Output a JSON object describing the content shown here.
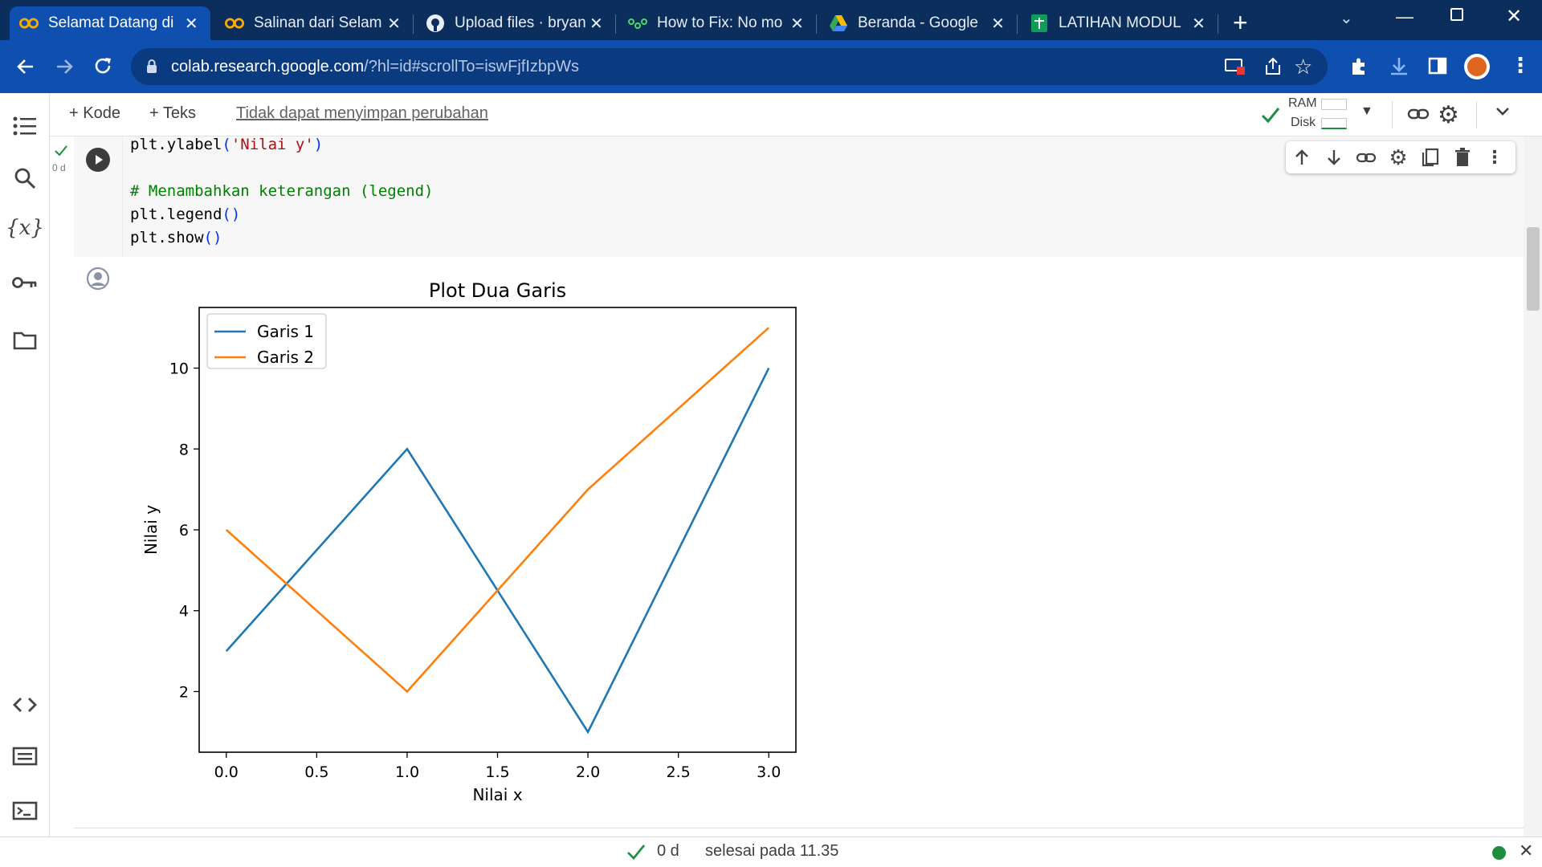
{
  "browser": {
    "tabs": [
      {
        "title": "Selamat Datang di",
        "icon": "colab-icon",
        "active": true
      },
      {
        "title": "Salinan dari Selam",
        "icon": "colab-icon",
        "active": false
      },
      {
        "title": "Upload files · bryan",
        "icon": "github-icon",
        "active": false
      },
      {
        "title": "How to Fix: No mo",
        "icon": "share-nodes-icon",
        "active": false
      },
      {
        "title": "Beranda - Google",
        "icon": "drive-icon",
        "active": false
      },
      {
        "title": "LATIHAN MODUL",
        "icon": "sheets-icon",
        "active": false
      }
    ],
    "url_domain": "colab.research.google.com",
    "url_path": "/?hl=id#scrollTo=iswFjfIzbpWs"
  },
  "colab": {
    "add_code_label": "+ Kode",
    "add_text_label": "+ Teks",
    "unsaved_notice": "Tidak dapat menyimpan perubahan",
    "ram_label": "RAM",
    "disk_label": "Disk"
  },
  "cell": {
    "exec_time": "0 d",
    "code_lines": [
      {
        "parts": [
          [
            "plain",
            "plt.ylabel"
          ],
          [
            "par",
            "("
          ],
          [
            "str",
            "'Nilai y'"
          ],
          [
            "par",
            ")"
          ]
        ]
      },
      {
        "parts": [
          [
            "plain",
            ""
          ]
        ]
      },
      {
        "parts": [
          [
            "cmt",
            "# Menambahkan keterangan (legend)"
          ]
        ]
      },
      {
        "parts": [
          [
            "plain",
            "plt.legend"
          ],
          [
            "par",
            "()"
          ]
        ]
      },
      {
        "parts": [
          [
            "plain",
            "plt.show"
          ],
          [
            "par",
            "()"
          ]
        ]
      }
    ]
  },
  "chart_data": {
    "type": "line",
    "title": "Plot Dua Garis",
    "xlabel": "Nilai x",
    "ylabel": "Nilai y",
    "x": [
      0,
      1,
      2,
      3
    ],
    "series": [
      {
        "name": "Garis 1",
        "values": [
          3,
          8,
          1,
          10
        ],
        "color": "#1f77b4"
      },
      {
        "name": "Garis 2",
        "values": [
          6,
          2,
          7,
          11
        ],
        "color": "#ff7f0e"
      }
    ],
    "xlim": [
      -0.15,
      3.15
    ],
    "ylim": [
      0.5,
      11.5
    ],
    "xticks": [
      "0.0",
      "0.5",
      "1.0",
      "1.5",
      "2.0",
      "2.5",
      "3.0"
    ],
    "xtick_values": [
      0,
      0.5,
      1,
      1.5,
      2,
      2.5,
      3
    ],
    "yticks": [
      "2",
      "4",
      "6",
      "8",
      "10"
    ],
    "ytick_values": [
      2,
      4,
      6,
      8,
      10
    ],
    "legend": "top-left",
    "grid": false
  },
  "status": {
    "time": "0 d",
    "message": "selesai pada 11.35"
  }
}
